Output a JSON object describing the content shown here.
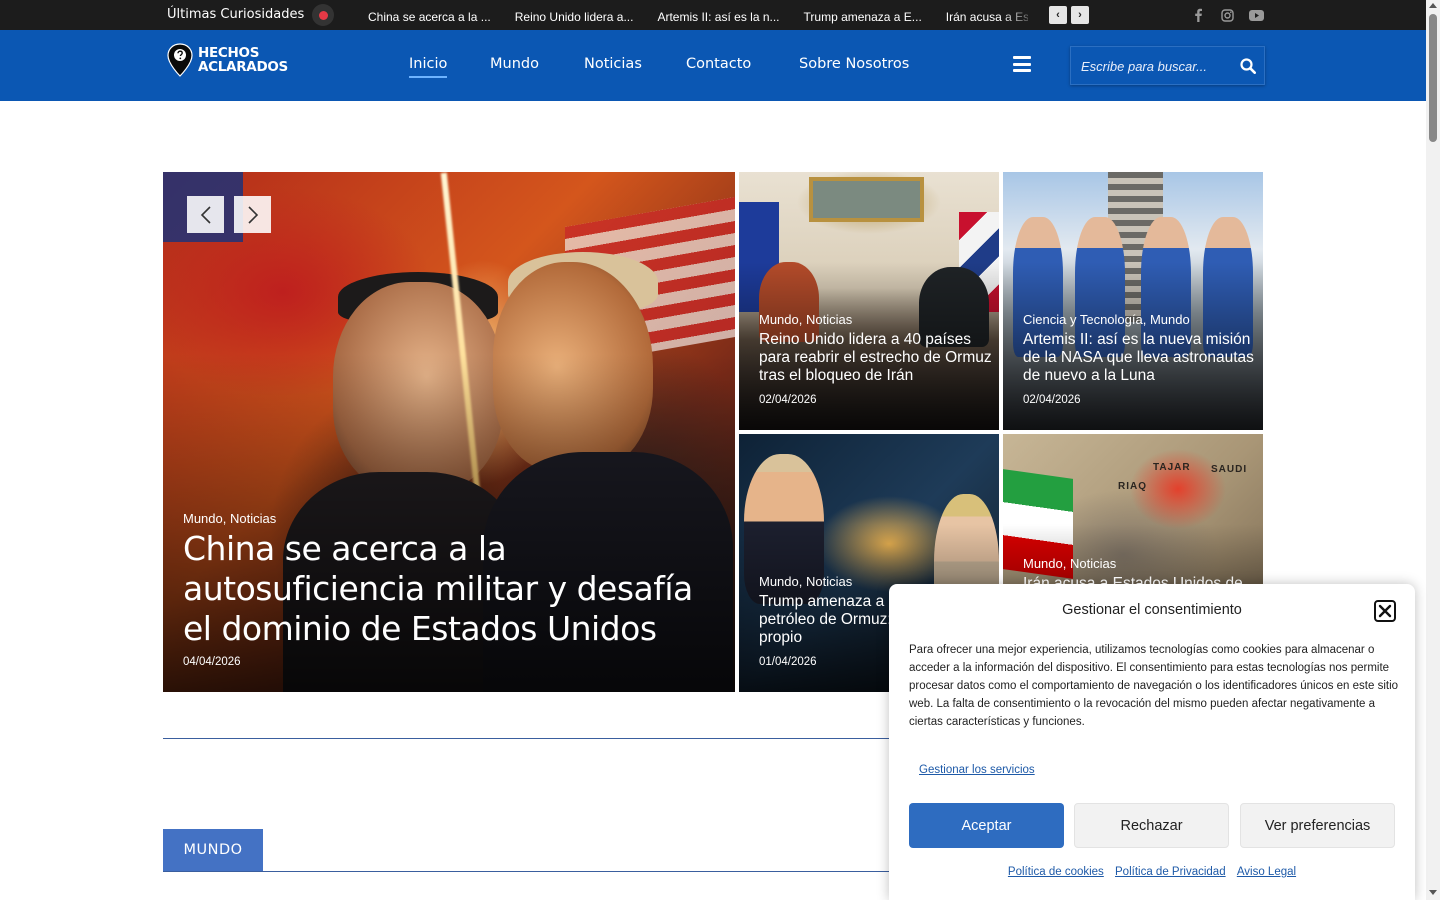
{
  "topbar": {
    "title": "Últimas Curiosidades",
    "ticker": [
      "China se acerca a la ...",
      "Reino Unido lidera a...",
      "Artemis II: así es la n...",
      "Trump amenaza a E...",
      "Irán acusa a Estados..."
    ],
    "prev_label": "‹",
    "next_label": "›",
    "social": [
      "facebook-icon",
      "instagram-icon",
      "youtube-icon"
    ]
  },
  "header": {
    "logo_line1": "HECHOS",
    "logo_line2": "ACLARADOS",
    "nav": [
      "Inicio",
      "Mundo",
      "Noticias",
      "Contacto",
      "Sobre Nosotros"
    ],
    "active": "Inicio",
    "search_placeholder": "Escribe para buscar..."
  },
  "hero": {
    "main": {
      "category": "Mundo, Noticias",
      "title": "China se acerca a la autosuficiencia militar y desafía el dominio de Estados Unidos",
      "date": "04/04/2026"
    },
    "cards": [
      {
        "category": "Mundo, Noticias",
        "title": "Reino Unido lidera a 40 países para reabrir el estrecho de Ormuz tras el bloqueo de Irán",
        "date": "02/04/2026"
      },
      {
        "category": "Ciencia y Tecnología, Mundo",
        "title": "Artemis II: así es la nueva misión de la NASA que lleva astronautas de nuevo a la Luna",
        "date": "02/04/2026"
      },
      {
        "category": "Mundo, Noticias",
        "title": "Trump amenaza a Europa con el petróleo de Ormuz: buscar su propio",
        "date": "01/04/2026"
      },
      {
        "category": "Mundo, Noticias",
        "title": "Irán acusa a Estados Unidos de",
        "date": ""
      }
    ],
    "map_labels": [
      "TAJAR",
      "SAUDI",
      "RIAQ"
    ]
  },
  "section": {
    "label": "MUNDO"
  },
  "consent": {
    "title": "Gestionar el consentimiento",
    "body": "Para ofrecer una mejor experiencia, utilizamos tecnologías como cookies para almacenar o acceder a la información del dispositivo. El consentimiento para estas tecnologías nos permite procesar datos como el comportamiento de navegación o los identificadores únicos en este sitio web. La falta de consentimiento o la revocación del mismo pueden afectar negativamente a ciertas características y funciones.",
    "services_link": "Gestionar los servicios",
    "accept": "Aceptar",
    "reject": "Rechazar",
    "preferences": "Ver preferencias",
    "links": [
      "Política de cookies",
      "Política de Privacidad",
      "Aviso Legal"
    ]
  },
  "colors": {
    "header_bg": "#0b57b3",
    "topbar_bg": "#1c1c1c",
    "accent": "#2e6cc0",
    "section_tab": "#4472c4"
  }
}
